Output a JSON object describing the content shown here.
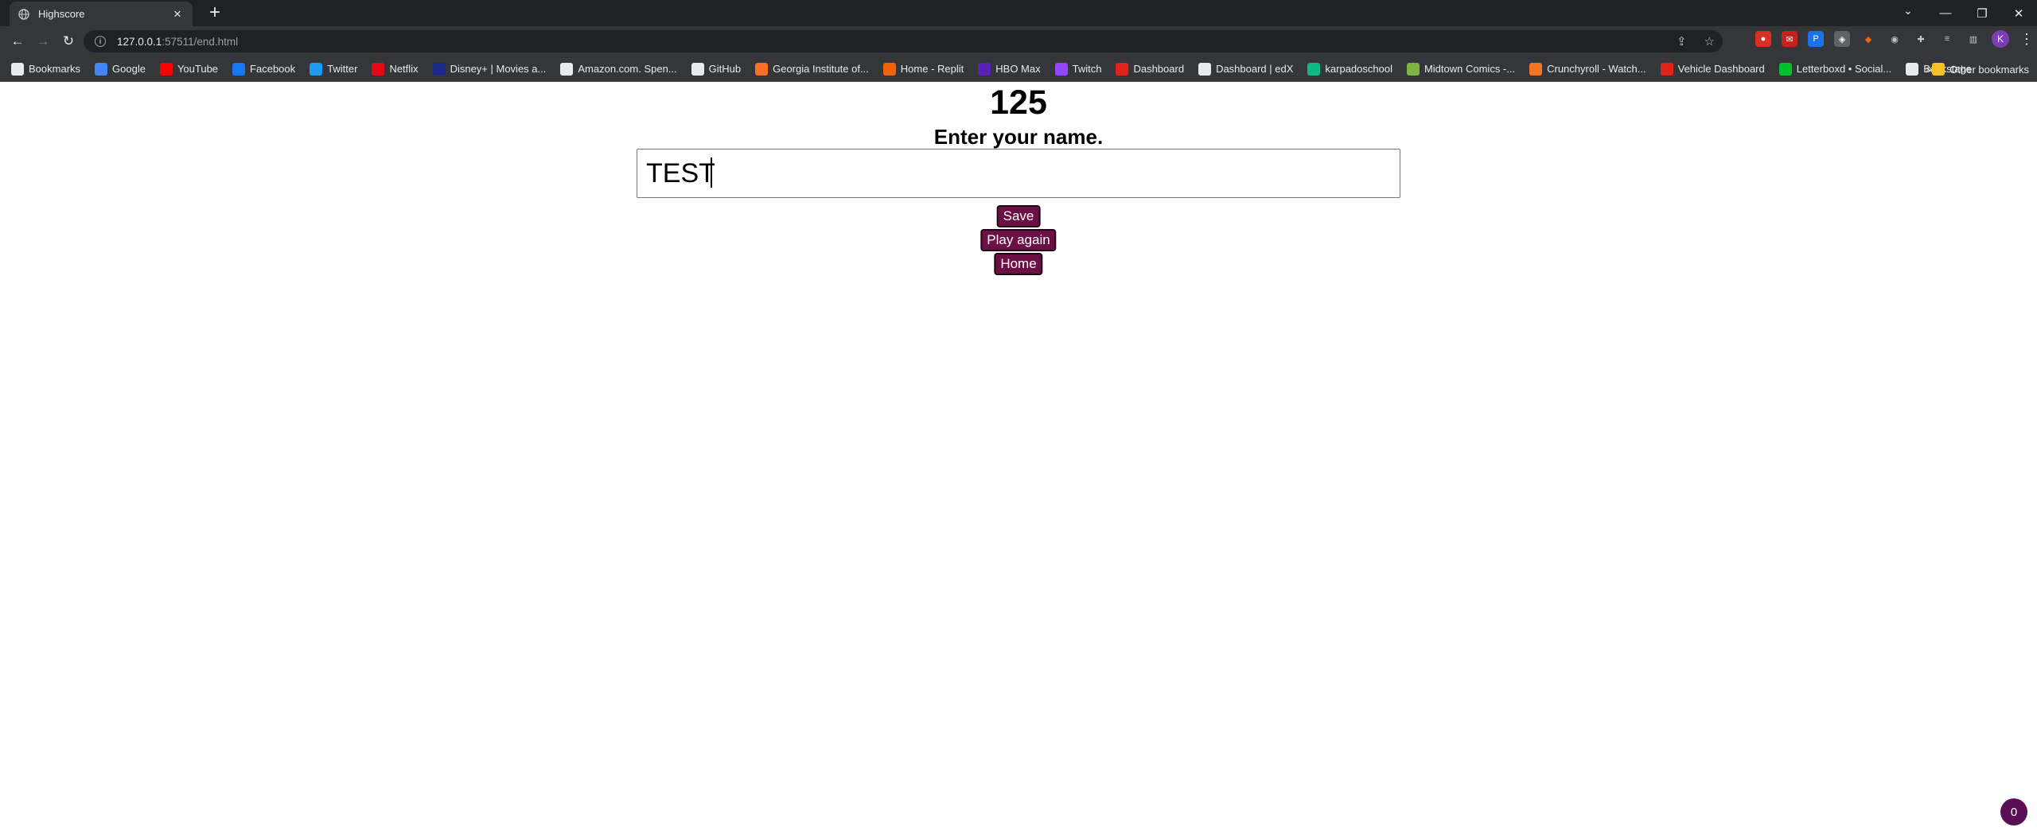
{
  "browser": {
    "tab_title": "Highscore",
    "url_host": "127.0.0.1",
    "url_rest": ":57511/end.html",
    "profile_initial": "K"
  },
  "bookmarks": [
    {
      "label": "Bookmarks",
      "icon": "star-icon",
      "color": "#e8eaed"
    },
    {
      "label": "Google",
      "icon": "google-icon",
      "color": "#4285f4"
    },
    {
      "label": "YouTube",
      "icon": "youtube-icon",
      "color": "#ff0000"
    },
    {
      "label": "Facebook",
      "icon": "facebook-icon",
      "color": "#1877f2"
    },
    {
      "label": "Twitter",
      "icon": "twitter-icon",
      "color": "#1d9bf0"
    },
    {
      "label": "Netflix",
      "icon": "netflix-icon",
      "color": "#e50914"
    },
    {
      "label": "Disney+ | Movies a...",
      "icon": "disney-icon",
      "color": "#1a2a8c"
    },
    {
      "label": "Amazon.com. Spen...",
      "icon": "amazon-icon",
      "color": "#e8eaed"
    },
    {
      "label": "GitHub",
      "icon": "github-icon",
      "color": "#e8eaed"
    },
    {
      "label": "Georgia Institute of...",
      "icon": "gitlab-icon",
      "color": "#fc6d26"
    },
    {
      "label": "Home - Replit",
      "icon": "replit-icon",
      "color": "#f26207"
    },
    {
      "label": "HBO Max",
      "icon": "hbo-icon",
      "color": "#5822b4"
    },
    {
      "label": "Twitch",
      "icon": "twitch-icon",
      "color": "#9146ff"
    },
    {
      "label": "Dashboard",
      "icon": "dashboard-icon",
      "color": "#e2231a"
    },
    {
      "label": "Dashboard | edX",
      "icon": "edx-icon",
      "color": "#e8eaed"
    },
    {
      "label": "karpadoschool",
      "icon": "karpado-icon",
      "color": "#10b981"
    },
    {
      "label": "Midtown Comics -...",
      "icon": "comics-icon",
      "color": "#7cb342"
    },
    {
      "label": "Crunchyroll - Watch...",
      "icon": "crunchyroll-icon",
      "color": "#f47521"
    },
    {
      "label": "Vehicle Dashboard",
      "icon": "vehicle-icon",
      "color": "#e2231a"
    },
    {
      "label": "Letterboxd • Social...",
      "icon": "letterboxd-icon",
      "color": "#00c030"
    },
    {
      "label": "Backstage",
      "icon": "backstage-icon",
      "color": "#e8eaed"
    }
  ],
  "other_bookmarks": "Other bookmarks",
  "page": {
    "score": "125",
    "prompt": "Enter your name.",
    "name_value": "TEST",
    "save_label": "Save",
    "play_again_label": "Play again",
    "home_label": "Home",
    "badge_count": "0"
  }
}
